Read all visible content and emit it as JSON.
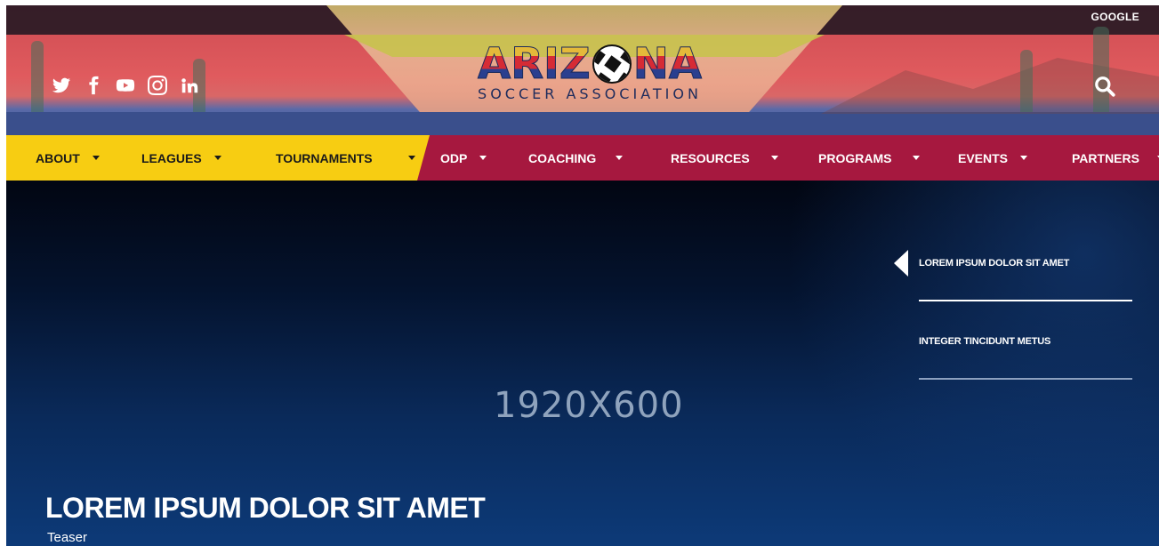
{
  "header": {
    "google_label": "GOOGLE",
    "social": [
      "twitter-icon",
      "facebook-icon",
      "youtube-icon",
      "instagram-icon",
      "linkedin-icon"
    ],
    "logo": {
      "word_left": "ARIZ",
      "word_right": "NA",
      "subtitle": "SOCCER ASSOCIATION"
    },
    "search_icon": "search-icon"
  },
  "nav": {
    "items": [
      {
        "label": "ABOUT",
        "caret": true
      },
      {
        "label": "LEAGUES",
        "caret": true
      },
      {
        "label": "TOURNAMENTS",
        "caret": true
      },
      {
        "label": "ODP",
        "caret": true
      },
      {
        "label": "COACHING",
        "caret": true
      },
      {
        "label": "RESOURCES",
        "caret": true
      },
      {
        "label": "PROGRAMS",
        "caret": true
      },
      {
        "label": "EVENTS",
        "caret": true
      },
      {
        "label": "PARTNERS",
        "caret": true
      }
    ],
    "colors": {
      "yellow": "#f7cd12",
      "red": "#a6183f"
    }
  },
  "hero": {
    "placeholder": "1920X600",
    "title": "LOREM IPSUM DOLOR SIT AMET",
    "teaser": "Teaser",
    "slides": [
      {
        "label": "LOREM IPSUM DOLOR SIT AMET",
        "active": true
      },
      {
        "label": "INTEGER TINCIDUNT METUS",
        "active": false
      }
    ]
  }
}
